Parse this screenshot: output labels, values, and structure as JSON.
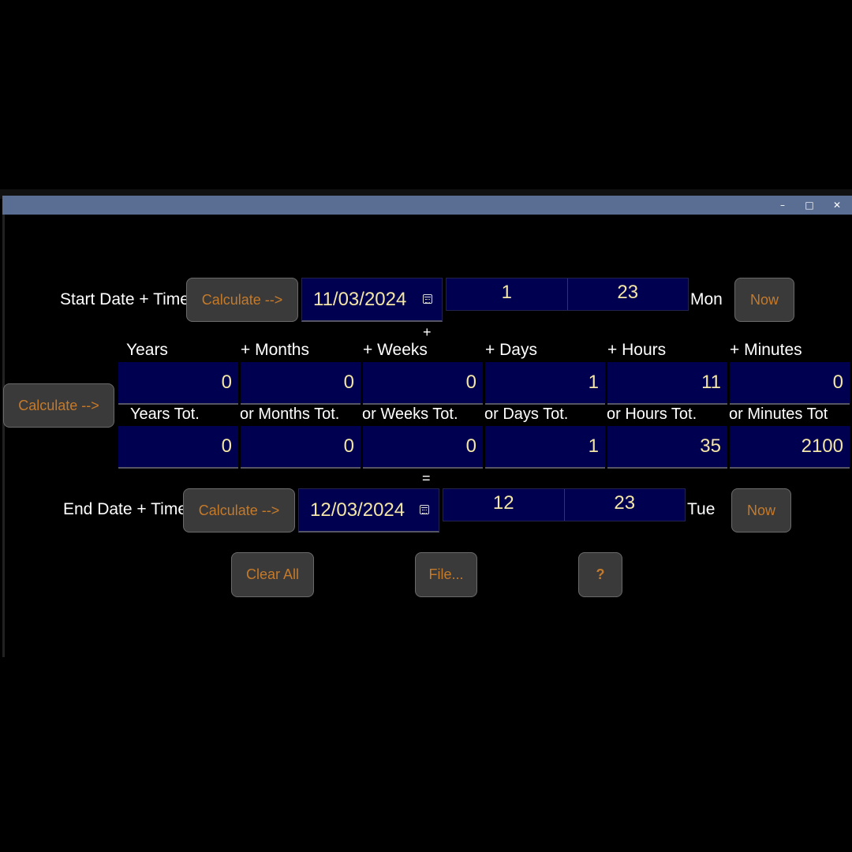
{
  "window": {
    "controls": {
      "minimize": "–",
      "maximize": "□",
      "close": "✕"
    }
  },
  "start": {
    "label": "Start Date + Time",
    "calc_button": "Calculate -->",
    "date": "11/03/2024",
    "hour": "1",
    "minute": "23",
    "weekday": "Mon",
    "now_button": "Now"
  },
  "plus_sign": "+",
  "offsets": {
    "calc_button": "Calculate -->",
    "headers": [
      "Years",
      "+ Months",
      "+ Weeks",
      "+ Days",
      "+ Hours",
      "+ Minutes"
    ],
    "values": [
      "0",
      "0",
      "0",
      "1",
      "11",
      "0"
    ],
    "total_headers": [
      "Years Tot.",
      "or Months Tot.",
      "or Weeks Tot.",
      "or Days Tot.",
      "or Hours Tot.",
      "or Minutes Tot"
    ],
    "total_values": [
      "0",
      "0",
      "0",
      "1",
      "35",
      "2100"
    ]
  },
  "equals_sign": "=",
  "end": {
    "label": "End Date + Time",
    "calc_button": "Calculate -->",
    "date": "12/03/2024",
    "hour": "12",
    "minute": "23",
    "weekday": "Tue",
    "now_button": "Now"
  },
  "footer": {
    "clear_all": "Clear All",
    "file": "File...",
    "help": "?"
  },
  "colors": {
    "field_bg": "#000050",
    "field_text": "#f3e6a6",
    "button_text": "#c57a2a",
    "titlebar": "#5a6e94"
  }
}
